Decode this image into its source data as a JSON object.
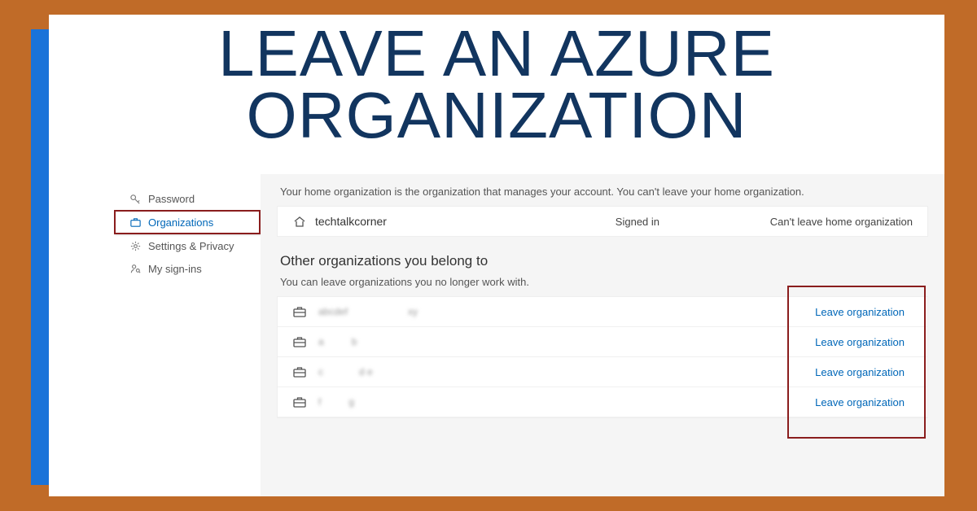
{
  "headline_line1": "LEAVE AN AZURE",
  "headline_line2": "ORGANIZATION",
  "sidebar": {
    "items": [
      {
        "label": ""
      },
      {
        "label": "Password"
      },
      {
        "label": "Organizations"
      },
      {
        "label": "Settings & Privacy"
      },
      {
        "label": "My sign-ins"
      }
    ]
  },
  "main": {
    "home_desc": "Your home organization is the organization that manages your account. You can't leave your home organization.",
    "home_org": "techtalkcorner",
    "signed_in": "Signed in",
    "cant_leave": "Can't leave home organization",
    "other_title": "Other organizations you belong to",
    "other_desc": "You can leave organizations you no longer work with.",
    "leave_label": "Leave organization",
    "orgs": [
      {
        "a": "abcdef",
        "b": "xy"
      },
      {
        "a": "a",
        "b": "b"
      },
      {
        "a": "c",
        "b": "d e"
      },
      {
        "a": "f",
        "b": "g"
      }
    ]
  }
}
